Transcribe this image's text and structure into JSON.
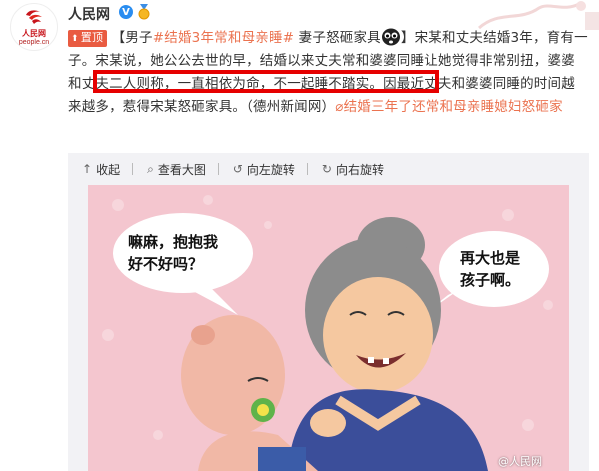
{
  "account": {
    "name": "人民网",
    "logo_text": "人民网",
    "logo_site": "people.cn",
    "verified_mark": "V"
  },
  "post": {
    "pinned_label": "置顶",
    "segments": {
      "lead": "【男子",
      "hashtag1": "#结婚3年常和母亲睡#",
      "after_hashtag": " 妻子怒砸家具",
      "after_emoji": "】宋某和丈夫结婚3年，育有一子。宋某说，她公公去世的早，结婚以来丈夫常和婆婆同睡让她觉得非常别扭，",
      "highlighted": "婆婆和丈夫二人则称，一直相依为命，不一起睡不踏实。",
      "tail": "因最近丈夫和婆婆同睡的时间越来越多，惹得宋某怒砸家具。（德州新闻网）",
      "link_text": "结婚三年了还常和母亲睡媳妇怒砸家"
    }
  },
  "toolbar": {
    "collapse": "收起",
    "view_large": "查看大图",
    "rotate_left": "向左旋转",
    "rotate_right": "向右旋转"
  },
  "image": {
    "bubble_left": [
      "嘛麻，抱抱我",
      "好不好吗？"
    ],
    "bubble_right": [
      "再大也是",
      "孩子啊。"
    ],
    "watermark": "@人民网"
  },
  "colors": {
    "accent_link": "#eb7350",
    "pin_bg": "#e95b41",
    "highlight_border": "#e60000",
    "panel_bg": "#f2f2f5",
    "image_bg": "#f4c6cf"
  }
}
